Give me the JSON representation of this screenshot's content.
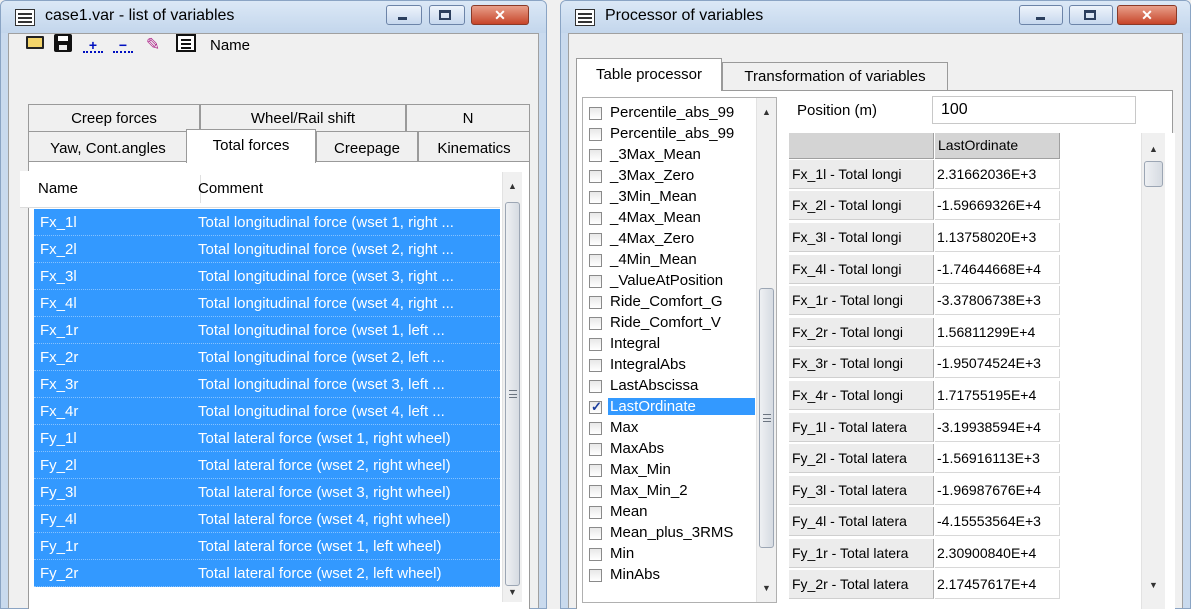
{
  "left_window": {
    "title": "case1.var - list of variables",
    "controls": {
      "minimize": "–",
      "maximize": "□",
      "close": "✕"
    },
    "toolbar": {
      "open_icon": "folder-open-icon",
      "save_icon": "floppy-disk-icon",
      "add_icon": "add-variable-icon",
      "remove_icon": "remove-variable-icon",
      "tool_icon": "tool-icon",
      "list_icon": "list-icon",
      "name_label": "Name"
    },
    "tabs_row1": [
      "Creep forces",
      "Wheel/Rail shift",
      "N"
    ],
    "tabs_row2": [
      "Yaw, Cont.angles",
      "Total forces",
      "Creepage",
      "Kinematics"
    ],
    "active_tab": "Total forces",
    "list": {
      "columns": [
        "Name",
        "Comment"
      ],
      "rows": [
        {
          "name": "Fx_1l",
          "comment": "Total longitudinal force (wset 1, right ..."
        },
        {
          "name": "Fx_2l",
          "comment": "Total longitudinal force (wset 2, right ..."
        },
        {
          "name": "Fx_3l",
          "comment": "Total longitudinal force (wset 3, right ..."
        },
        {
          "name": "Fx_4l",
          "comment": "Total longitudinal force (wset 4, right ..."
        },
        {
          "name": "Fx_1r",
          "comment": "Total longitudinal force (wset 1, left ..."
        },
        {
          "name": "Fx_2r",
          "comment": "Total longitudinal force (wset 2, left ..."
        },
        {
          "name": "Fx_3r",
          "comment": "Total longitudinal force (wset 3, left ..."
        },
        {
          "name": "Fx_4r",
          "comment": "Total longitudinal force (wset 4, left ..."
        },
        {
          "name": "Fy_1l",
          "comment": "Total lateral force (wset 1, right wheel)"
        },
        {
          "name": "Fy_2l",
          "comment": "Total lateral force (wset 2, right wheel)"
        },
        {
          "name": "Fy_3l",
          "comment": "Total lateral force (wset 3, right wheel)"
        },
        {
          "name": "Fy_4l",
          "comment": "Total lateral force (wset 4, right wheel)"
        },
        {
          "name": "Fy_1r",
          "comment": "Total lateral force (wset 1, left wheel)"
        },
        {
          "name": "Fy_2r",
          "comment": "Total lateral force (wset 2, left wheel)"
        }
      ]
    }
  },
  "right_window": {
    "title": "Processor of variables",
    "controls": {
      "minimize": "–",
      "maximize": "□",
      "close": "✕"
    },
    "tabs": [
      "Table processor",
      "Transformation of variables"
    ],
    "active_tab": "Table processor",
    "functions": [
      {
        "label": "Percentile_abs_99",
        "checked": false
      },
      {
        "label": "Percentile_abs_99",
        "checked": false
      },
      {
        "label": "_3Max_Mean",
        "checked": false
      },
      {
        "label": "_3Max_Zero",
        "checked": false
      },
      {
        "label": "_3Min_Mean",
        "checked": false
      },
      {
        "label": "_4Max_Mean",
        "checked": false
      },
      {
        "label": "_4Max_Zero",
        "checked": false
      },
      {
        "label": "_4Min_Mean",
        "checked": false
      },
      {
        "label": "_ValueAtPosition",
        "checked": false
      },
      {
        "label": "Ride_Comfort_G",
        "checked": false
      },
      {
        "label": "Ride_Comfort_V",
        "checked": false
      },
      {
        "label": "Integral",
        "checked": false
      },
      {
        "label": "IntegralAbs",
        "checked": false
      },
      {
        "label": "LastAbscissa",
        "checked": false
      },
      {
        "label": "LastOrdinate",
        "checked": true,
        "selected": true
      },
      {
        "label": "Max",
        "checked": false
      },
      {
        "label": "MaxAbs",
        "checked": false
      },
      {
        "label": "Max_Min",
        "checked": false
      },
      {
        "label": "Max_Min_2",
        "checked": false
      },
      {
        "label": "Mean",
        "checked": false
      },
      {
        "label": "Mean_plus_3RMS",
        "checked": false
      },
      {
        "label": "Min",
        "checked": false
      },
      {
        "label": "MinAbs",
        "checked": false
      }
    ],
    "position_label": "Position (m)",
    "position_value": "100",
    "table": {
      "column": "LastOrdinate",
      "rows": [
        {
          "label": "Fx_1l - Total longi",
          "value": "2.31662036E+3"
        },
        {
          "label": "Fx_2l - Total longi",
          "value": "-1.59669326E+4"
        },
        {
          "label": "Fx_3l - Total longi",
          "value": "1.13758020E+3"
        },
        {
          "label": "Fx_4l - Total longi",
          "value": "-1.74644668E+4"
        },
        {
          "label": "Fx_1r - Total longi",
          "value": "-3.37806738E+3"
        },
        {
          "label": "Fx_2r - Total longi",
          "value": "1.56811299E+4"
        },
        {
          "label": "Fx_3r - Total longi",
          "value": "-1.95074524E+3"
        },
        {
          "label": "Fx_4r - Total longi",
          "value": "1.71755195E+4"
        },
        {
          "label": "Fy_1l - Total latera",
          "value": "-3.19938594E+4"
        },
        {
          "label": "Fy_2l - Total latera",
          "value": "-1.56916113E+3"
        },
        {
          "label": "Fy_3l - Total latera",
          "value": "-1.96987676E+4"
        },
        {
          "label": "Fy_4l - Total latera",
          "value": "-4.15553564E+3"
        },
        {
          "label": "Fy_1r - Total latera",
          "value": "2.30900840E+4"
        },
        {
          "label": "Fy_2r - Total latera",
          "value": "2.17457617E+4"
        }
      ]
    }
  }
}
